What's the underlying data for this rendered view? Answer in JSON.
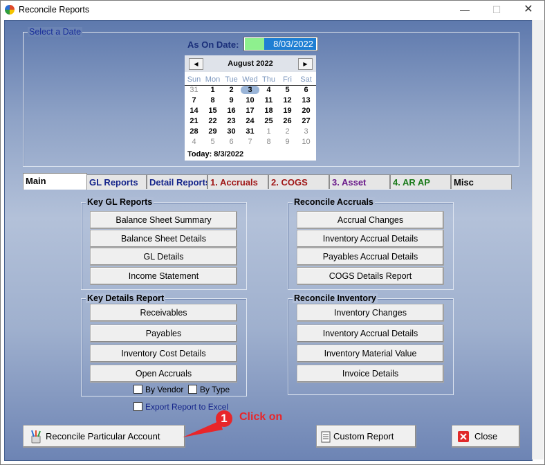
{
  "window": {
    "title": "Reconcile Reports",
    "min_glyph": "—",
    "max_glyph": "☐",
    "close_glyph": "✕"
  },
  "date_group": {
    "title": "Select a Date",
    "label": "As On Date:",
    "value": "8/03/2022"
  },
  "calendar": {
    "month": "August 2022",
    "prev": "◀",
    "next": "▶",
    "weekdays": [
      "Sun",
      "Mon",
      "Tue",
      "Wed",
      "Thu",
      "Fri",
      "Sat"
    ],
    "weeks": [
      [
        "31",
        "1",
        "2",
        "3",
        "4",
        "5",
        "6"
      ],
      [
        "7",
        "8",
        "9",
        "10",
        "11",
        "12",
        "13"
      ],
      [
        "14",
        "15",
        "16",
        "17",
        "18",
        "19",
        "20"
      ],
      [
        "21",
        "22",
        "23",
        "24",
        "25",
        "26",
        "27"
      ],
      [
        "28",
        "29",
        "30",
        "31",
        "1",
        "2",
        "3"
      ],
      [
        "4",
        "5",
        "6",
        "7",
        "8",
        "9",
        "10"
      ]
    ],
    "today_label": "Today: 8/3/2022"
  },
  "tabs": [
    {
      "label": "Main",
      "color": "#000000"
    },
    {
      "label": "GL Reports",
      "color": "#14248a"
    },
    {
      "label": "Detail Reports",
      "color": "#14248a"
    },
    {
      "label": "1. Accruals",
      "color": "#a01818"
    },
    {
      "label": "2. COGS",
      "color": "#a01818"
    },
    {
      "label": "3. Asset",
      "color": "#6a1a8a"
    },
    {
      "label": "4. AR AP",
      "color": "#1a7a1a"
    },
    {
      "label": "Misc",
      "color": "#000000"
    }
  ],
  "key_gl": {
    "title": "Key GL Reports",
    "buttons": [
      "Balance Sheet Summary",
      "Balance Sheet Details",
      "GL Details",
      "Income Statement"
    ]
  },
  "key_details": {
    "title": "Key Details Report",
    "buttons": [
      "Receivables",
      "Payables",
      "Inventory Cost Details",
      "Open Accruals"
    ]
  },
  "reconcile_accruals": {
    "title": "Reconcile Accruals",
    "buttons": [
      "Accrual Changes",
      "Inventory Accrual Details",
      "Payables Accrual Details",
      "COGS Details Report"
    ]
  },
  "reconcile_inventory": {
    "title": "Reconcile Inventory",
    "buttons": [
      "Inventory Changes",
      "Inventory Accrual Details",
      "Inventory Material Value",
      "Invoice Details"
    ]
  },
  "checks": {
    "by_vendor": "By Vendor",
    "by_type": "By Type",
    "export": "Export Report to Excel"
  },
  "bottom": {
    "reconcile": "Reconcile Particular Account",
    "custom": "Custom Report",
    "close": "Close"
  },
  "callout": {
    "number": "1",
    "text": "Click on",
    "color": "#e8262a"
  }
}
